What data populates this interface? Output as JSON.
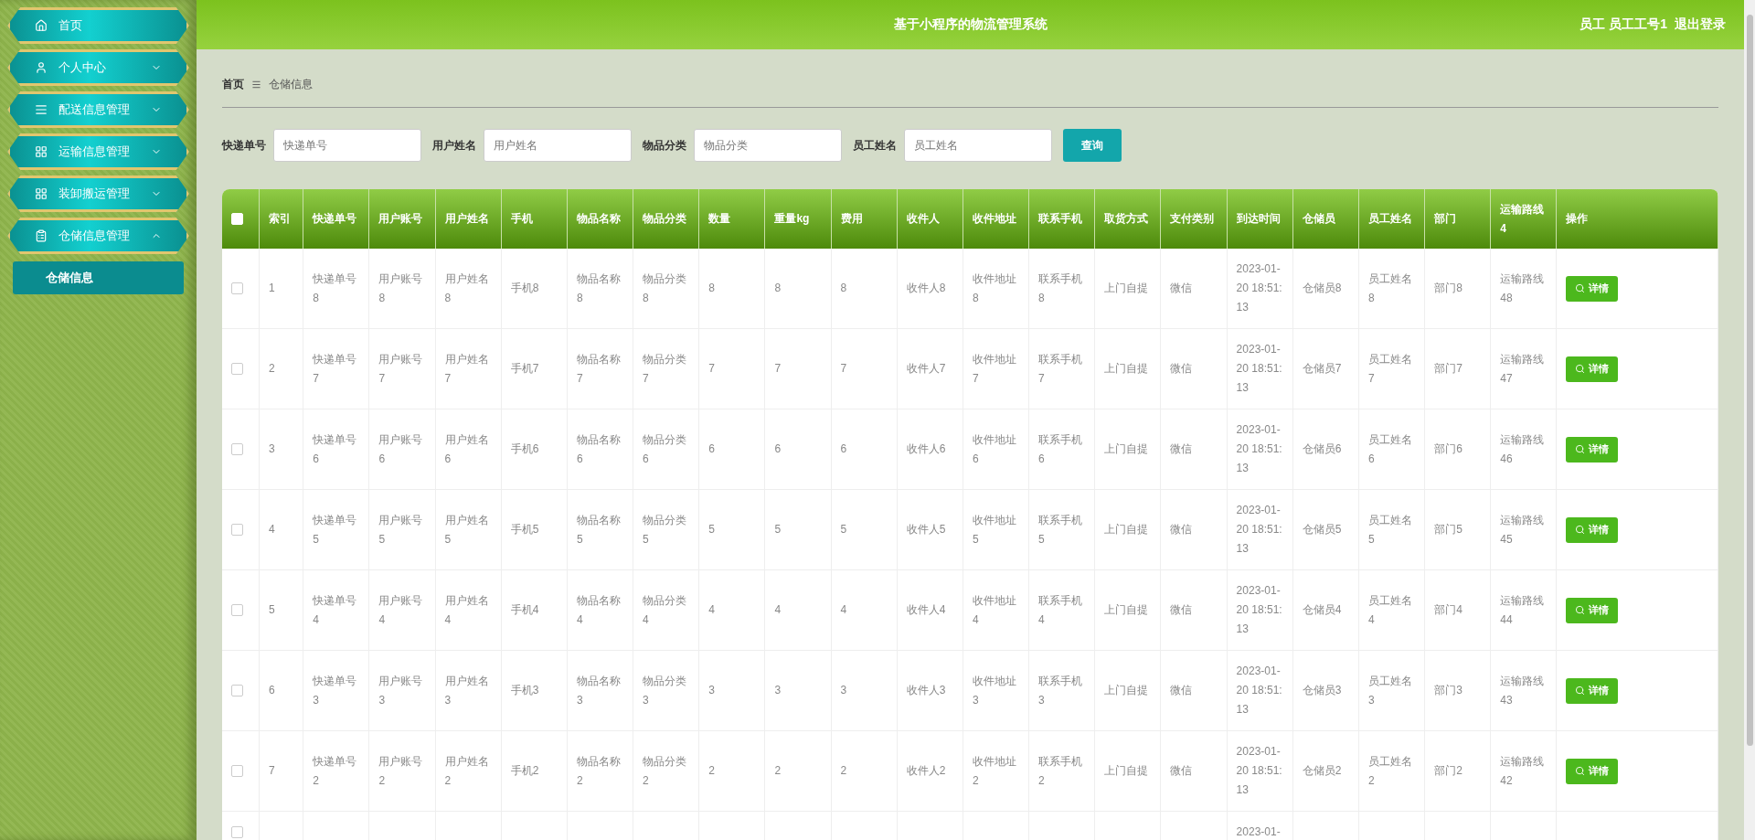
{
  "header": {
    "title": "基于小程序的物流管理系统",
    "user": "员工 员工工号1",
    "logout": "退出登录"
  },
  "sidebar": {
    "items": [
      {
        "label": "首页",
        "kind": "link"
      },
      {
        "label": "个人中心",
        "kind": "menu",
        "expanded": false
      },
      {
        "label": "配送信息管理",
        "kind": "menu",
        "expanded": false
      },
      {
        "label": "运输信息管理",
        "kind": "menu",
        "expanded": false
      },
      {
        "label": "装卸搬运管理",
        "kind": "menu",
        "expanded": false
      },
      {
        "label": "仓储信息管理",
        "kind": "menu",
        "expanded": true,
        "children": [
          {
            "label": "仓储信息",
            "selected": true
          }
        ]
      }
    ]
  },
  "breadcrumb": [
    "首页",
    "仓储信息"
  ],
  "search": {
    "fields": [
      {
        "label": "快递单号",
        "placeholder": "快递单号"
      },
      {
        "label": "用户姓名",
        "placeholder": "用户姓名"
      },
      {
        "label": "物品分类",
        "placeholder": "物品分类"
      },
      {
        "label": "员工姓名",
        "placeholder": "员工姓名"
      }
    ],
    "button": "查询"
  },
  "table": {
    "select_all": {
      "checked": false
    },
    "columns": [
      "索引",
      "快递单号",
      "用户账号",
      "用户姓名",
      "手机",
      "物品名称",
      "物品分类",
      "数量",
      "重量kg",
      "费用",
      "收件人",
      "收件地址",
      "联系手机",
      "取货方式",
      "支付类别",
      "到达时间",
      "仓储员",
      "员工姓名",
      "部门",
      "运输路线4",
      "操作"
    ],
    "rows": [
      {
        "checked": false,
        "cells": [
          "1",
          "快递单号8",
          "用户账号8",
          "用户姓名8",
          "手机8",
          "物品名称8",
          "物品分类8",
          "8",
          "8",
          "8",
          "收件人8",
          "收件地址8",
          "联系手机8",
          "上门自提",
          "微信",
          "2023-01-20 18:51:13",
          "仓储员8",
          "员工姓名8",
          "部门8",
          "运输路线48"
        ],
        "action": "详情"
      },
      {
        "checked": false,
        "cells": [
          "2",
          "快递单号7",
          "用户账号7",
          "用户姓名7",
          "手机7",
          "物品名称7",
          "物品分类7",
          "7",
          "7",
          "7",
          "收件人7",
          "收件地址7",
          "联系手机7",
          "上门自提",
          "微信",
          "2023-01-20 18:51:13",
          "仓储员7",
          "员工姓名7",
          "部门7",
          "运输路线47"
        ],
        "action": "详情"
      },
      {
        "checked": false,
        "cells": [
          "3",
          "快递单号6",
          "用户账号6",
          "用户姓名6",
          "手机6",
          "物品名称6",
          "物品分类6",
          "6",
          "6",
          "6",
          "收件人6",
          "收件地址6",
          "联系手机6",
          "上门自提",
          "微信",
          "2023-01-20 18:51:13",
          "仓储员6",
          "员工姓名6",
          "部门6",
          "运输路线46"
        ],
        "action": "详情"
      },
      {
        "checked": false,
        "cells": [
          "4",
          "快递单号5",
          "用户账号5",
          "用户姓名5",
          "手机5",
          "物品名称5",
          "物品分类5",
          "5",
          "5",
          "5",
          "收件人5",
          "收件地址5",
          "联系手机5",
          "上门自提",
          "微信",
          "2023-01-20 18:51:13",
          "仓储员5",
          "员工姓名5",
          "部门5",
          "运输路线45"
        ],
        "action": "详情"
      },
      {
        "checked": false,
        "cells": [
          "5",
          "快递单号4",
          "用户账号4",
          "用户姓名4",
          "手机4",
          "物品名称4",
          "物品分类4",
          "4",
          "4",
          "4",
          "收件人4",
          "收件地址4",
          "联系手机4",
          "上门自提",
          "微信",
          "2023-01-20 18:51:13",
          "仓储员4",
          "员工姓名4",
          "部门4",
          "运输路线44"
        ],
        "action": "详情"
      },
      {
        "checked": false,
        "cells": [
          "6",
          "快递单号3",
          "用户账号3",
          "用户姓名3",
          "手机3",
          "物品名称3",
          "物品分类3",
          "3",
          "3",
          "3",
          "收件人3",
          "收件地址3",
          "联系手机3",
          "上门自提",
          "微信",
          "2023-01-20 18:51:13",
          "仓储员3",
          "员工姓名3",
          "部门3",
          "运输路线43"
        ],
        "action": "详情"
      },
      {
        "checked": false,
        "cells": [
          "7",
          "快递单号2",
          "用户账号2",
          "用户姓名2",
          "手机2",
          "物品名称2",
          "物品分类2",
          "2",
          "2",
          "2",
          "收件人2",
          "收件地址2",
          "联系手机2",
          "上门自提",
          "微信",
          "2023-01-20 18:51:13",
          "仓储员2",
          "员工姓名2",
          "部门2",
          "运输路线42"
        ],
        "action": "详情"
      },
      {
        "checked": false,
        "cells": [
          null,
          null,
          null,
          null,
          null,
          null,
          null,
          null,
          null,
          null,
          null,
          null,
          null,
          null,
          null,
          "2023-01-",
          null,
          null,
          null,
          null
        ]
      }
    ]
  }
}
